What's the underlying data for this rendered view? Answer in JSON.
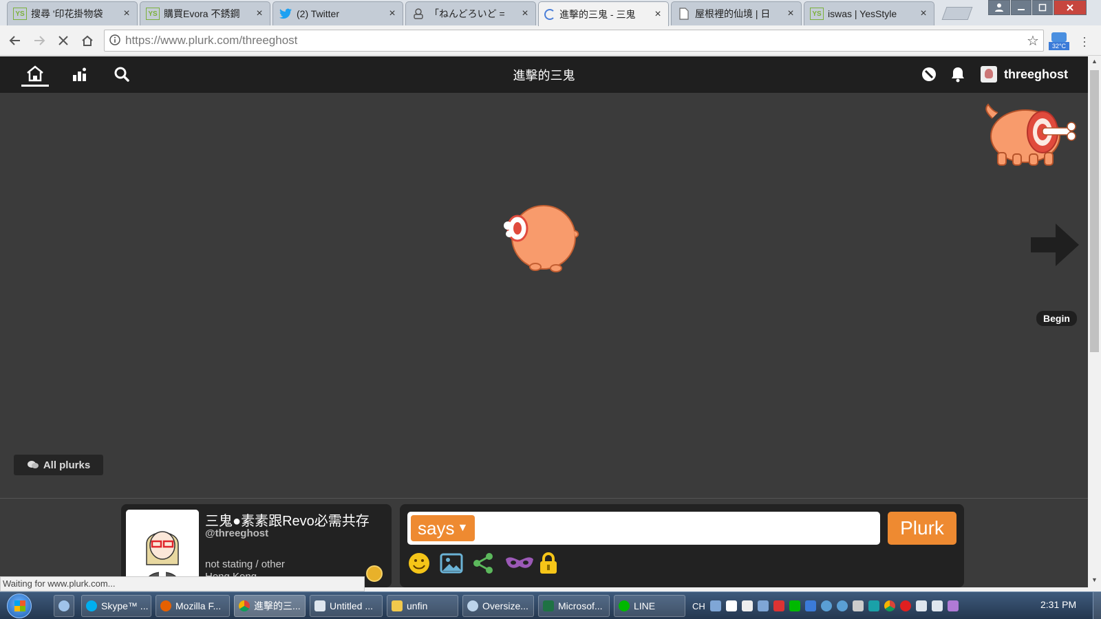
{
  "browser": {
    "tabs": [
      {
        "favicon": "yesstyle-icon",
        "label": "搜尋 '印花掛物袋"
      },
      {
        "favicon": "yesstyle-icon",
        "label": "購買Evora 不銹鋼"
      },
      {
        "favicon": "twitter-icon",
        "label": "(2) Twitter"
      },
      {
        "favicon": "robot-icon",
        "label": "「ねんどろいど ="
      },
      {
        "favicon": "loading-icon",
        "label": "進擊的三鬼 - 三鬼"
      },
      {
        "favicon": "document-icon",
        "label": "屋根裡的仙境 | 日"
      },
      {
        "favicon": "yesstyle-icon",
        "label": "iswas | YesStyle"
      }
    ],
    "address_domain": "https://www.plurk.com/",
    "address_path": "threeghost",
    "weather_temp": "32°C"
  },
  "plurk": {
    "page_title": "進擊的三鬼",
    "username": "threeghost",
    "begin_label": "Begin",
    "all_plurks_label": "All plurks",
    "profile": {
      "display_name": "三鬼●素素跟Revo必需共存",
      "handle": "@threeghost",
      "status": "not stating / other",
      "location": "Hong Kong"
    },
    "composer": {
      "qualifier": "says",
      "placeholder": "",
      "submit_label": "Plurk"
    }
  },
  "status_bar": "Waiting for www.plurk.com...",
  "taskbar": {
    "buttons": [
      {
        "icon": "skype-icon",
        "label": "Skype™ ..."
      },
      {
        "icon": "firefox-icon",
        "label": "Mozilla F..."
      },
      {
        "icon": "chrome-icon",
        "label": "進擊的三..."
      },
      {
        "icon": "notepad-icon",
        "label": "Untitled ..."
      },
      {
        "icon": "folder-icon",
        "label": "unfin"
      },
      {
        "icon": "search-icon",
        "label": "Oversize..."
      },
      {
        "icon": "excel-icon",
        "label": "Microsof..."
      },
      {
        "icon": "line-icon",
        "label": "LINE"
      }
    ],
    "language": "CH",
    "time": "2:31 PM"
  },
  "colors": {
    "accent": "#ee8a31",
    "page_bg": "#3b3b3b",
    "nav_bg": "#1f1f1f",
    "mascot": "#f89b6c"
  }
}
